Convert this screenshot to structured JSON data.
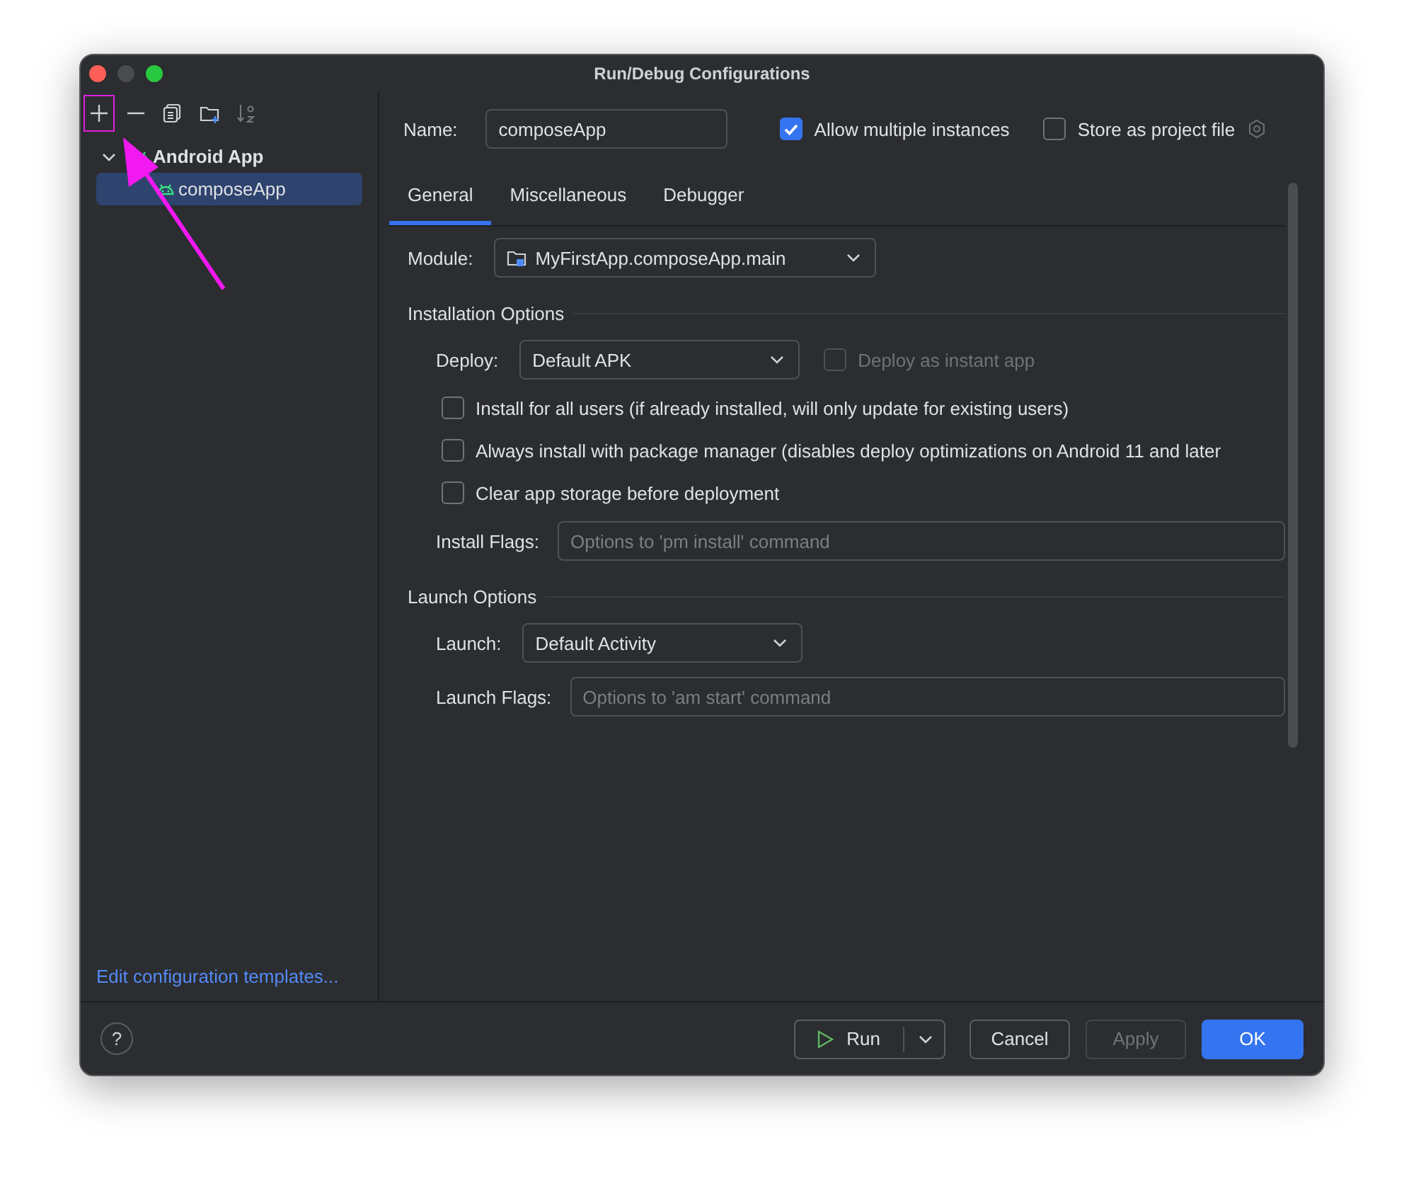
{
  "window": {
    "title": "Run/Debug Configurations"
  },
  "toolbar": [
    {
      "kind": "add",
      "disabled": false,
      "highlighted": true
    },
    {
      "kind": "remove",
      "disabled": false,
      "highlighted": false
    },
    {
      "kind": "copy",
      "disabled": false,
      "highlighted": false
    },
    {
      "kind": "folder",
      "disabled": false,
      "highlighted": false
    },
    {
      "kind": "sort",
      "disabled": true,
      "highlighted": false
    }
  ],
  "tree": [
    {
      "label": "Android App",
      "expanded": true,
      "selected": false,
      "children": [
        {
          "label": "composeApp",
          "selected": true
        }
      ]
    }
  ],
  "sidebar_link": "Edit configuration templates...",
  "name": {
    "label": "Name:",
    "value": "composeApp"
  },
  "header_checks": [
    {
      "label": "Allow multiple instances",
      "checked": true
    },
    {
      "label": "Store as project file",
      "checked": false
    }
  ],
  "tabs": [
    {
      "label": "General",
      "selected": true
    },
    {
      "label": "Miscellaneous",
      "selected": false
    },
    {
      "label": "Debugger",
      "selected": false
    }
  ],
  "module": {
    "label": "Module:",
    "value": "MyFirstApp.composeApp.main"
  },
  "sections": [
    {
      "title": "Installation Options",
      "rows": [
        {
          "kind": "dropdown",
          "label": "Deploy:",
          "value": "Default APK",
          "extra": {
            "label": "Deploy as instant app",
            "checked": false,
            "disabled": true
          }
        },
        {
          "kind": "checkbox",
          "label": "Install for all users (if already installed, will only update for existing users)",
          "checked": false
        },
        {
          "kind": "checkbox",
          "label": "Always install with package manager (disables deploy optimizations on Android 11 and later",
          "checked": false
        },
        {
          "kind": "checkbox",
          "label": "Clear app storage before deployment",
          "checked": false
        },
        {
          "kind": "field",
          "label": "Install Flags:",
          "placeholder": "Options to 'pm install' command"
        }
      ]
    },
    {
      "title": "Launch Options",
      "rows": [
        {
          "kind": "dropdown",
          "label": "Launch:",
          "value": "Default Activity"
        },
        {
          "kind": "field",
          "label": "Launch Flags:",
          "placeholder": "Options to 'am start' command"
        }
      ]
    }
  ],
  "footer": {
    "help": "?",
    "buttons": [
      {
        "label": "Run",
        "kind": "run",
        "disabled": false
      },
      {
        "label": "Cancel",
        "kind": "normal",
        "disabled": false
      },
      {
        "label": "Apply",
        "kind": "normal",
        "disabled": true
      },
      {
        "label": "OK",
        "kind": "primary",
        "disabled": false
      }
    ]
  }
}
